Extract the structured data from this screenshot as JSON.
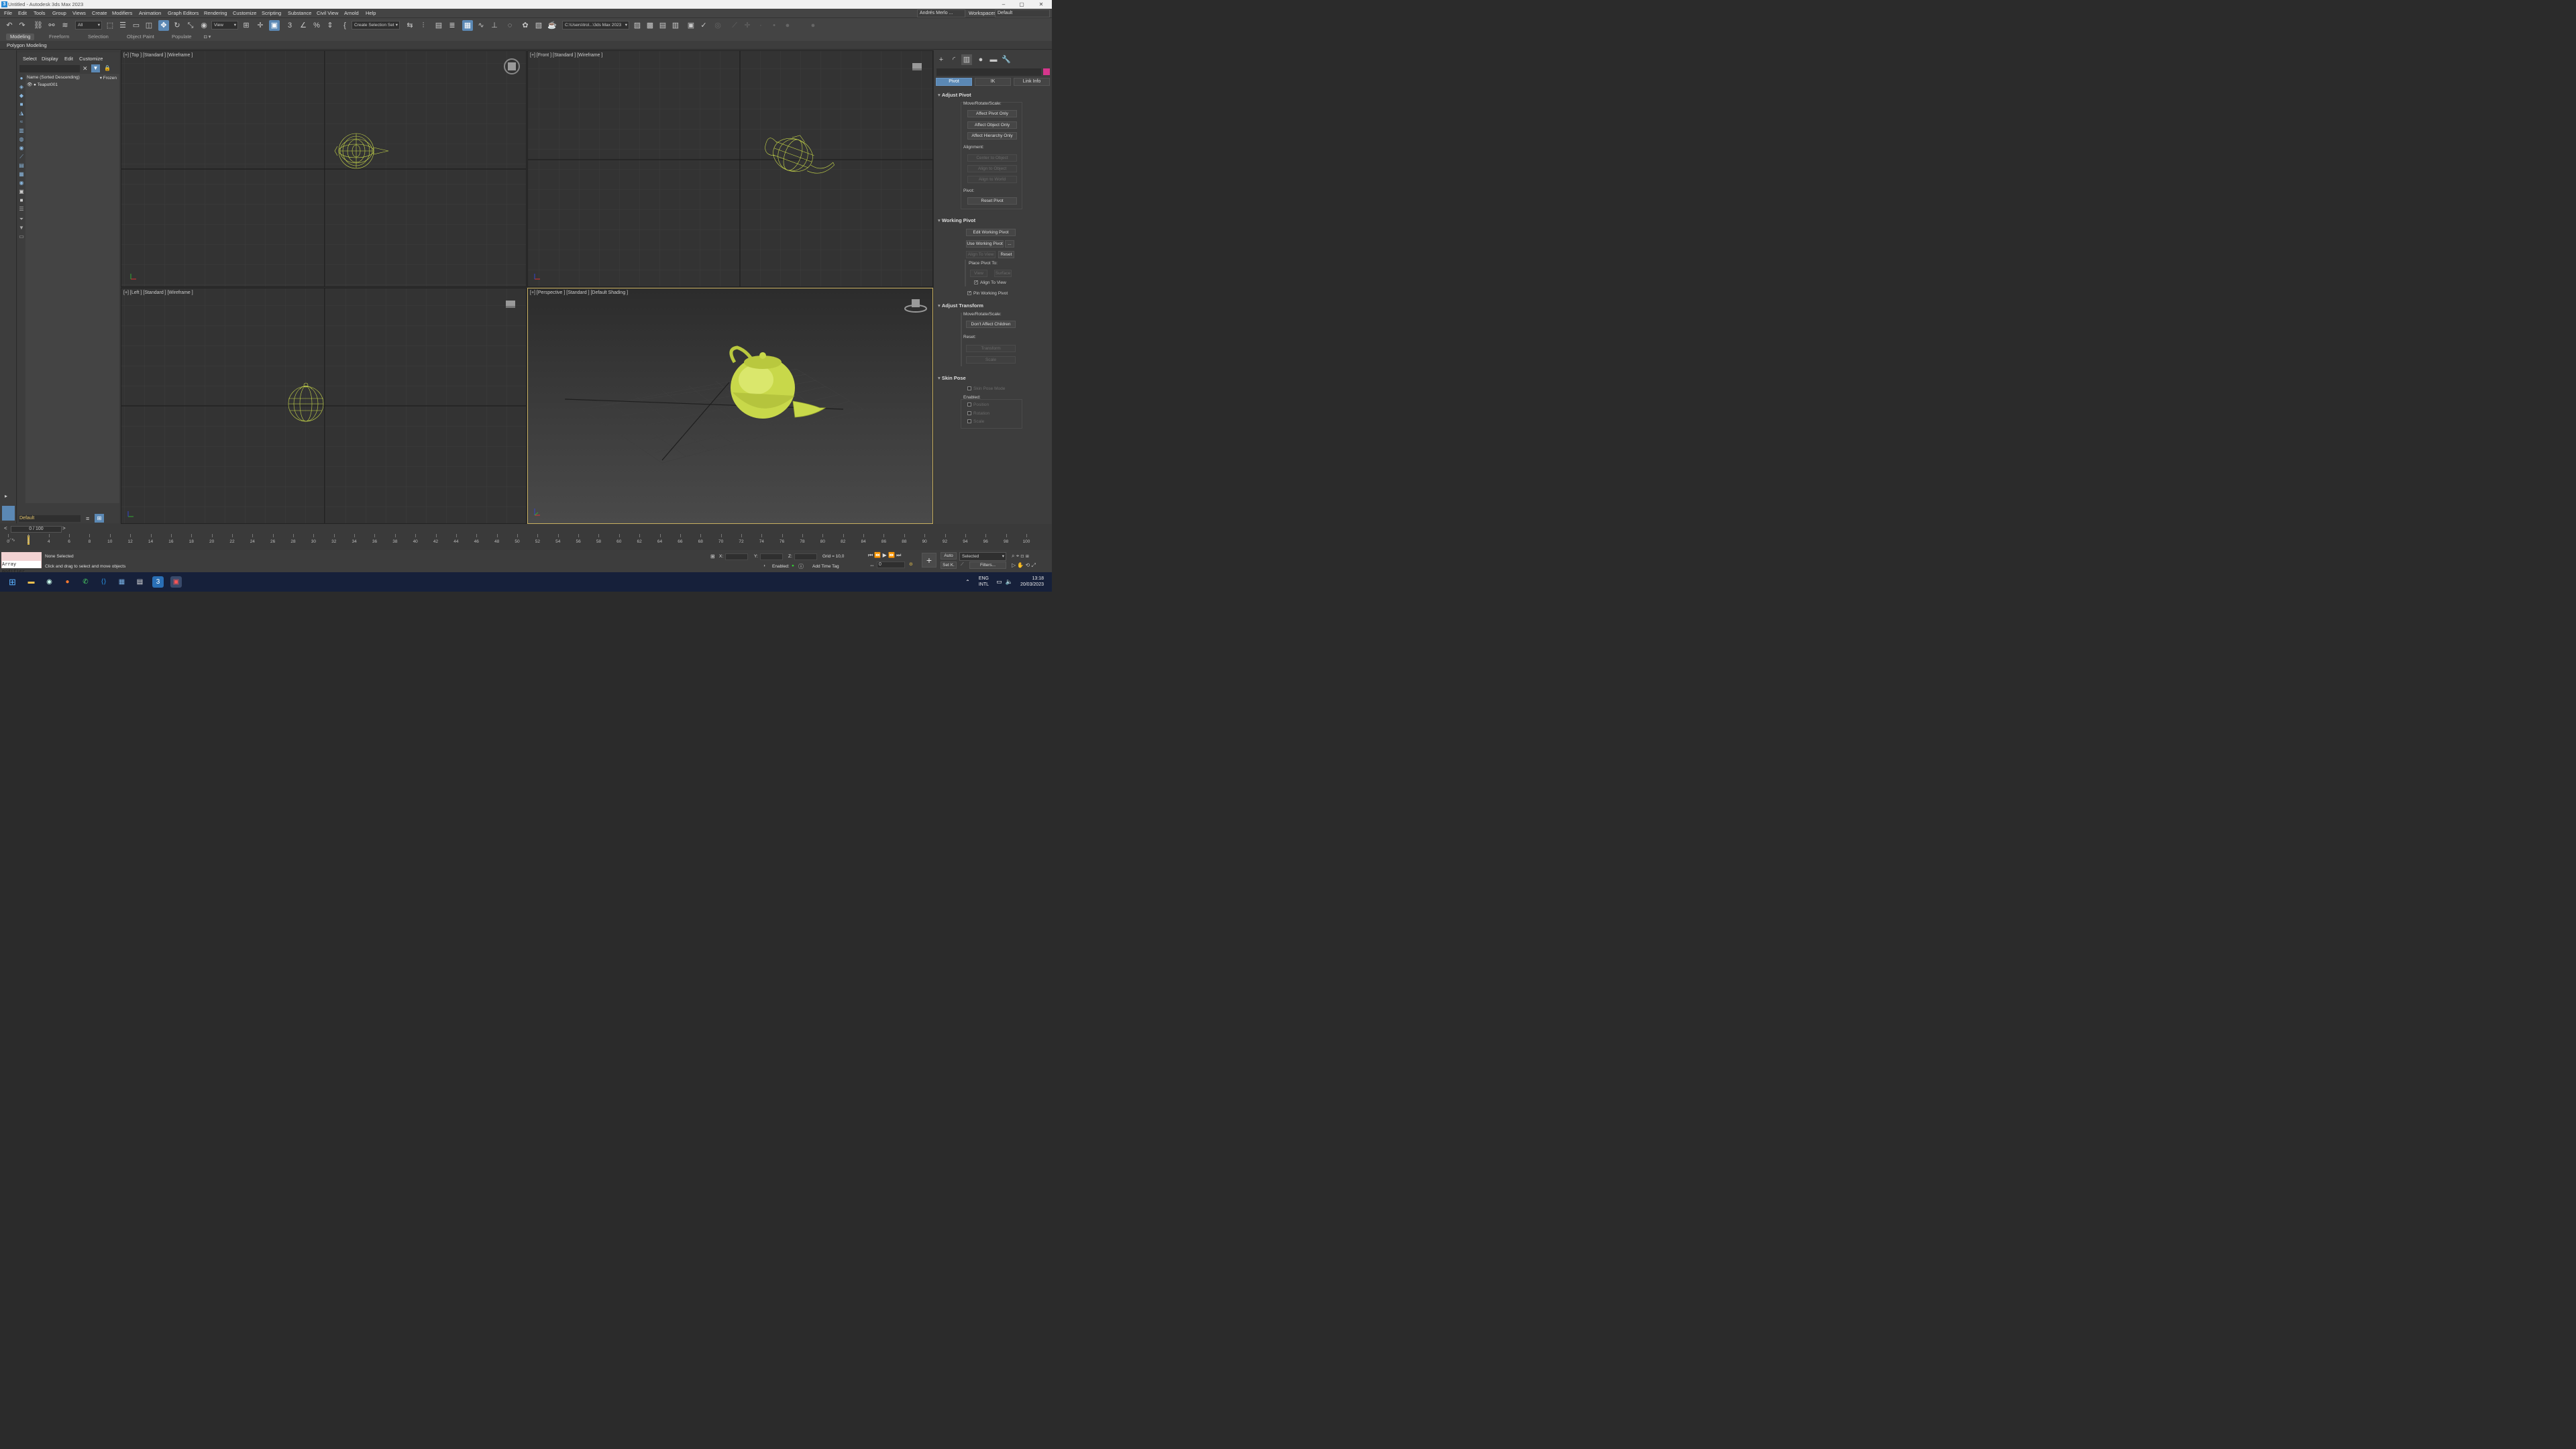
{
  "window": {
    "title": "Untitled - Autodesk 3ds Max 2023",
    "minimize": "–",
    "maximize": "▢",
    "close": "✕"
  },
  "menu": [
    "File",
    "Edit",
    "Tools",
    "Group",
    "Views",
    "Create",
    "Modifiers",
    "Animation",
    "Graph Editors",
    "Rendering",
    "Customize",
    "Scripting",
    "Substance",
    "Civil View",
    "Arnold",
    "Help"
  ],
  "user": "Andrés Merlo ...",
  "workspaces_label": "Workspaces:",
  "workspace_value": "Default",
  "toolbar": {
    "selection_filter": "All",
    "ref_coord": "View",
    "selection_set": "Create Selection Set",
    "project_path": "C:\\Users\\trol...\\3ds Max 2023"
  },
  "ribbon": {
    "tabs": [
      "Modeling",
      "Freeform",
      "Selection",
      "Object Paint",
      "Populate"
    ],
    "active": "Modeling",
    "panel": "Polygon Modeling"
  },
  "scene_explorer": {
    "tabs": [
      "Select",
      "Display",
      "Edit",
      "Customize"
    ],
    "column": "Name (Sorted Descending)",
    "frozen": "▾ Frozen",
    "object": "Teapot001",
    "layer": "Default"
  },
  "viewports": {
    "top": "[+] [Top ] [Standard ] [Wireframe ]",
    "front": "[+] [Front ] [Standard ] [Wireframe ]",
    "left": "[+] [Left ] [Standard ] [Wireframe ]",
    "perspective": "[+] [Perspective ] [Standard ] [Default Shading ]"
  },
  "command_panel": {
    "tabs": [
      "Pivot",
      "IK",
      "Link Info"
    ],
    "adjust_pivot": {
      "title": "Adjust Pivot",
      "move_label": "Move/Rotate/Scale:",
      "buttons": [
        "Affect Pivot Only",
        "Affect Object Only",
        "Affect Hierarchy Only"
      ],
      "alignment_label": "Alignment:",
      "align_buttons": [
        "Center to Object",
        "Align to Object",
        "Align to World"
      ],
      "pivot_label": "Pivot:",
      "reset": "Reset Pivot"
    },
    "working_pivot": {
      "title": "Working Pivot",
      "edit": "Edit Working Pivot",
      "use": "Use Working Pivot",
      "use_more": "...",
      "align_view": "Align To View",
      "reset": "Reset",
      "place_label": "Place Pivot To:",
      "view": "View",
      "surface": "Surface",
      "align_to_view_chk": "Align To View",
      "pin": "Pin Working Pivot"
    },
    "adjust_transform": {
      "title": "Adjust Transform",
      "move_label": "Move/Rotate/Scale:",
      "dont_affect": "Don't Affect Children",
      "reset_label": "Reset:",
      "transform": "Transform",
      "scale": "Scale"
    },
    "skin_pose": {
      "title": "Skin Pose",
      "mode": "Skin Pose Mode",
      "enabled_label": "Enabled:",
      "position": "Position",
      "rotation": "Rotation",
      "scale": "Scale"
    }
  },
  "timeline": {
    "frame": "0 / 100",
    "ticks": [
      "0",
      "2",
      "4",
      "6",
      "8",
      "10",
      "12",
      "14",
      "16",
      "18",
      "20",
      "22",
      "24",
      "26",
      "28",
      "30",
      "32",
      "34",
      "36",
      "38",
      "40",
      "42",
      "44",
      "46",
      "48",
      "50",
      "52",
      "54",
      "56",
      "58",
      "60",
      "62",
      "64",
      "66",
      "68",
      "70",
      "72",
      "74",
      "76",
      "78",
      "80",
      "82",
      "84",
      "86",
      "88",
      "90",
      "92",
      "94",
      "96",
      "98",
      "100"
    ],
    "prev": "<",
    "next": ">"
  },
  "status": {
    "selection": "None Selected",
    "prompt": "Click and drag to select and move objects",
    "maxscript": "Array modifier",
    "x": "X:",
    "y": "Y:",
    "z": "Z:",
    "grid": "Grid = 10,0",
    "enabled": "Enabled:",
    "add_time_tag": "Add Time Tag",
    "auto": "Auto",
    "set_key": "Set K.",
    "selected": "Selected",
    "filters": "Filters...",
    "frame_field": "0"
  },
  "taskbar": {
    "lang1": "ENG",
    "lang2": "INTL",
    "time": "13:18",
    "date": "20/03/2023"
  },
  "colors": {
    "accent": "#5b88b4",
    "teapot": "#c8d84a",
    "active_border": "#c8b060",
    "taskbar": "#16203a"
  }
}
